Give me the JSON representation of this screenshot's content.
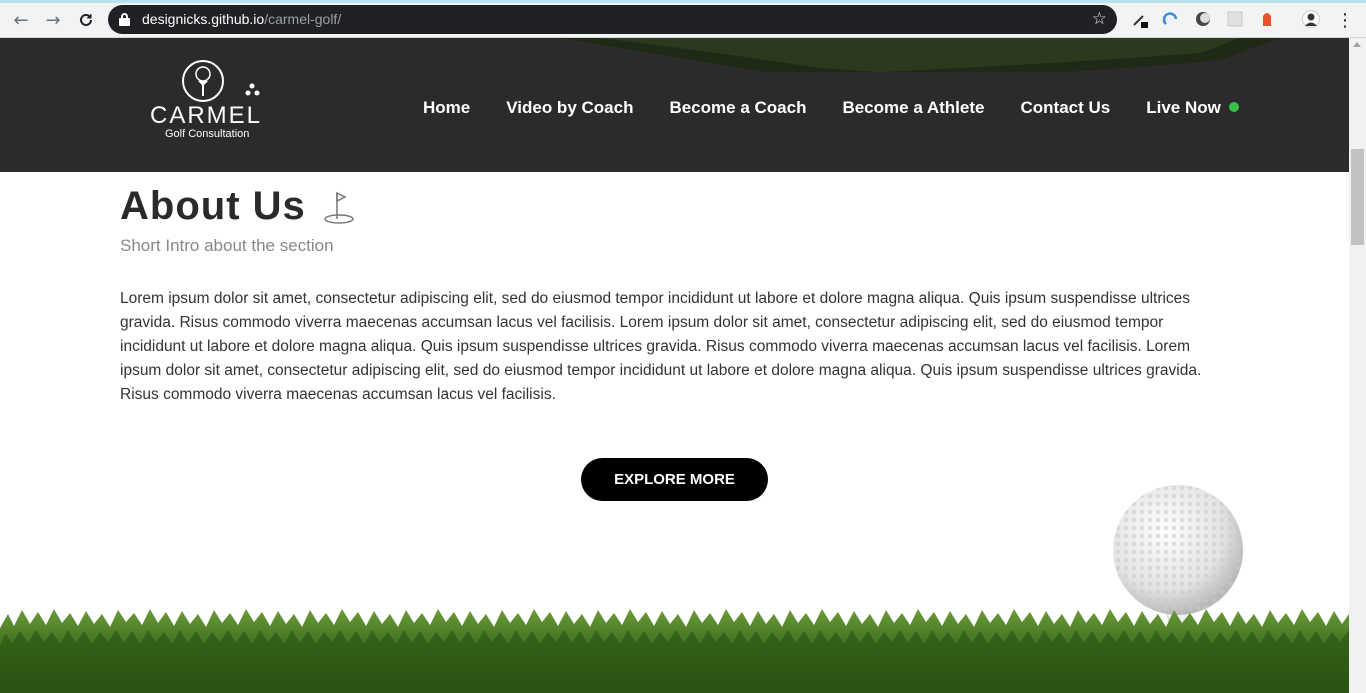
{
  "browser": {
    "url_host": "designicks.github.io",
    "url_path": "/carmel-golf/",
    "icons": [
      "back-arrow-icon",
      "forward-arrow-icon",
      "reload-icon",
      "lock-icon",
      "star-icon",
      "menu-dots-icon"
    ]
  },
  "header": {
    "logo": {
      "name": "CARMEL",
      "tagline": "Golf Consultation"
    },
    "nav": [
      {
        "label": "Home"
      },
      {
        "label": "Video by Coach"
      },
      {
        "label": "Become a Coach"
      },
      {
        "label": "Become a Athlete"
      },
      {
        "label": "Contact Us"
      },
      {
        "label": "Live Now"
      }
    ],
    "live_status_color": "#36c24a"
  },
  "about": {
    "title": "About Us",
    "intro": "Short Intro about the section",
    "body": "Lorem ipsum dolor sit amet, consectetur adipiscing elit, sed do eiusmod tempor incididunt ut labore et dolore magna aliqua. Quis ipsum suspendisse ultrices gravida. Risus commodo viverra maecenas accumsan lacus vel facilisis. Lorem ipsum dolor sit amet, consectetur adipiscing elit, sed do eiusmod tempor incididunt ut labore et dolore magna aliqua. Quis ipsum suspendisse ultrices gravida. Risus commodo viverra maecenas accumsan lacus vel facilisis. Lorem ipsum dolor sit amet, consectetur adipiscing elit, sed do eiusmod tempor incididunt ut labore et dolore magna aliqua. Quis ipsum suspendisse ultrices gravida. Risus commodo viverra maecenas accumsan lacus vel facilisis.",
    "cta": "EXPLORE MORE"
  },
  "colors": {
    "header_bg": "#2b2b2b",
    "button_bg": "#000000",
    "heading": "#2a2a2a",
    "intro": "#888888"
  }
}
